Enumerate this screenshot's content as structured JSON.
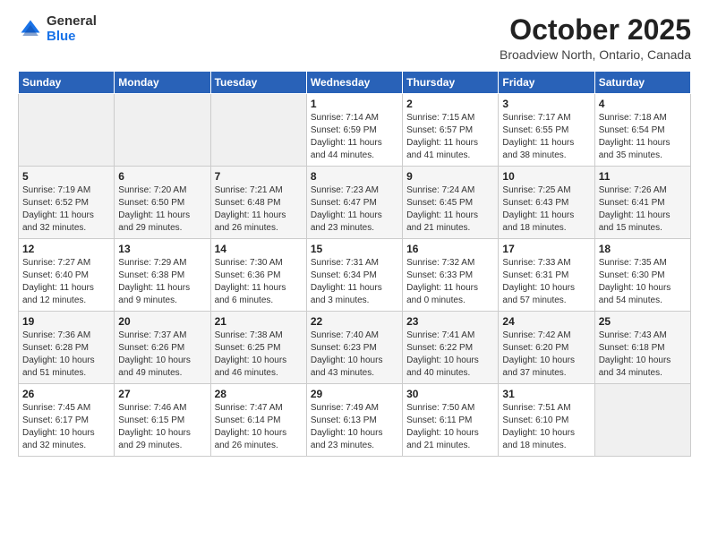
{
  "logo": {
    "general": "General",
    "blue": "Blue"
  },
  "title": "October 2025",
  "subtitle": "Broadview North, Ontario, Canada",
  "days_of_week": [
    "Sunday",
    "Monday",
    "Tuesday",
    "Wednesday",
    "Thursday",
    "Friday",
    "Saturday"
  ],
  "weeks": [
    [
      {
        "day": "",
        "info": ""
      },
      {
        "day": "",
        "info": ""
      },
      {
        "day": "",
        "info": ""
      },
      {
        "day": "1",
        "info": "Sunrise: 7:14 AM\nSunset: 6:59 PM\nDaylight: 11 hours and 44 minutes."
      },
      {
        "day": "2",
        "info": "Sunrise: 7:15 AM\nSunset: 6:57 PM\nDaylight: 11 hours and 41 minutes."
      },
      {
        "day": "3",
        "info": "Sunrise: 7:17 AM\nSunset: 6:55 PM\nDaylight: 11 hours and 38 minutes."
      },
      {
        "day": "4",
        "info": "Sunrise: 7:18 AM\nSunset: 6:54 PM\nDaylight: 11 hours and 35 minutes."
      }
    ],
    [
      {
        "day": "5",
        "info": "Sunrise: 7:19 AM\nSunset: 6:52 PM\nDaylight: 11 hours and 32 minutes."
      },
      {
        "day": "6",
        "info": "Sunrise: 7:20 AM\nSunset: 6:50 PM\nDaylight: 11 hours and 29 minutes."
      },
      {
        "day": "7",
        "info": "Sunrise: 7:21 AM\nSunset: 6:48 PM\nDaylight: 11 hours and 26 minutes."
      },
      {
        "day": "8",
        "info": "Sunrise: 7:23 AM\nSunset: 6:47 PM\nDaylight: 11 hours and 23 minutes."
      },
      {
        "day": "9",
        "info": "Sunrise: 7:24 AM\nSunset: 6:45 PM\nDaylight: 11 hours and 21 minutes."
      },
      {
        "day": "10",
        "info": "Sunrise: 7:25 AM\nSunset: 6:43 PM\nDaylight: 11 hours and 18 minutes."
      },
      {
        "day": "11",
        "info": "Sunrise: 7:26 AM\nSunset: 6:41 PM\nDaylight: 11 hours and 15 minutes."
      }
    ],
    [
      {
        "day": "12",
        "info": "Sunrise: 7:27 AM\nSunset: 6:40 PM\nDaylight: 11 hours and 12 minutes."
      },
      {
        "day": "13",
        "info": "Sunrise: 7:29 AM\nSunset: 6:38 PM\nDaylight: 11 hours and 9 minutes."
      },
      {
        "day": "14",
        "info": "Sunrise: 7:30 AM\nSunset: 6:36 PM\nDaylight: 11 hours and 6 minutes."
      },
      {
        "day": "15",
        "info": "Sunrise: 7:31 AM\nSunset: 6:34 PM\nDaylight: 11 hours and 3 minutes."
      },
      {
        "day": "16",
        "info": "Sunrise: 7:32 AM\nSunset: 6:33 PM\nDaylight: 11 hours and 0 minutes."
      },
      {
        "day": "17",
        "info": "Sunrise: 7:33 AM\nSunset: 6:31 PM\nDaylight: 10 hours and 57 minutes."
      },
      {
        "day": "18",
        "info": "Sunrise: 7:35 AM\nSunset: 6:30 PM\nDaylight: 10 hours and 54 minutes."
      }
    ],
    [
      {
        "day": "19",
        "info": "Sunrise: 7:36 AM\nSunset: 6:28 PM\nDaylight: 10 hours and 51 minutes."
      },
      {
        "day": "20",
        "info": "Sunrise: 7:37 AM\nSunset: 6:26 PM\nDaylight: 10 hours and 49 minutes."
      },
      {
        "day": "21",
        "info": "Sunrise: 7:38 AM\nSunset: 6:25 PM\nDaylight: 10 hours and 46 minutes."
      },
      {
        "day": "22",
        "info": "Sunrise: 7:40 AM\nSunset: 6:23 PM\nDaylight: 10 hours and 43 minutes."
      },
      {
        "day": "23",
        "info": "Sunrise: 7:41 AM\nSunset: 6:22 PM\nDaylight: 10 hours and 40 minutes."
      },
      {
        "day": "24",
        "info": "Sunrise: 7:42 AM\nSunset: 6:20 PM\nDaylight: 10 hours and 37 minutes."
      },
      {
        "day": "25",
        "info": "Sunrise: 7:43 AM\nSunset: 6:18 PM\nDaylight: 10 hours and 34 minutes."
      }
    ],
    [
      {
        "day": "26",
        "info": "Sunrise: 7:45 AM\nSunset: 6:17 PM\nDaylight: 10 hours and 32 minutes."
      },
      {
        "day": "27",
        "info": "Sunrise: 7:46 AM\nSunset: 6:15 PM\nDaylight: 10 hours and 29 minutes."
      },
      {
        "day": "28",
        "info": "Sunrise: 7:47 AM\nSunset: 6:14 PM\nDaylight: 10 hours and 26 minutes."
      },
      {
        "day": "29",
        "info": "Sunrise: 7:49 AM\nSunset: 6:13 PM\nDaylight: 10 hours and 23 minutes."
      },
      {
        "day": "30",
        "info": "Sunrise: 7:50 AM\nSunset: 6:11 PM\nDaylight: 10 hours and 21 minutes."
      },
      {
        "day": "31",
        "info": "Sunrise: 7:51 AM\nSunset: 6:10 PM\nDaylight: 10 hours and 18 minutes."
      },
      {
        "day": "",
        "info": ""
      }
    ]
  ]
}
